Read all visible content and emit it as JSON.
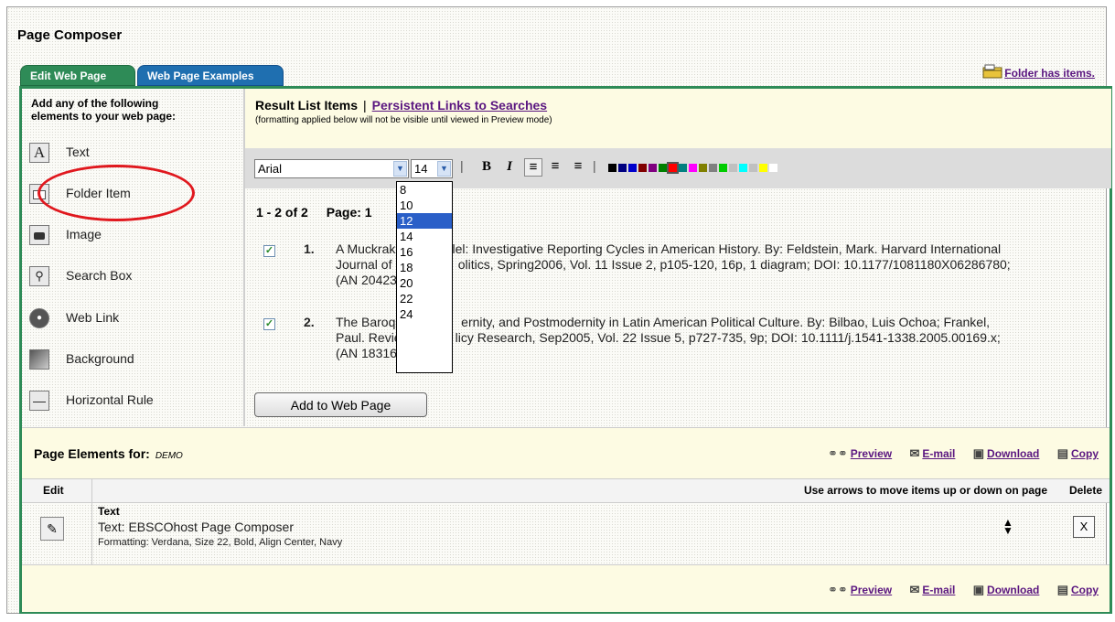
{
  "page_title": "Page Composer",
  "tabs": [
    {
      "label": "Edit Web Page"
    },
    {
      "label": "Web Page Examples"
    }
  ],
  "folder_link": "Folder has items.",
  "left_panel": {
    "title_line1": "Add any of the following",
    "title_line2": "elements to your web page:",
    "elements": [
      {
        "label": "Text",
        "icon": "text-A-icon"
      },
      {
        "label": "Folder Item",
        "icon": "folder-item-icon"
      },
      {
        "label": "Image",
        "icon": "camera-icon"
      },
      {
        "label": "Search Box",
        "icon": "magnifier-icon"
      },
      {
        "label": "Web Link",
        "icon": "globe-link-icon"
      },
      {
        "label": "Background",
        "icon": "background-icon"
      },
      {
        "label": "Horizontal Rule",
        "icon": "horizontal-rule-icon"
      }
    ]
  },
  "result_list": {
    "title": "Result List Items",
    "separator": "|",
    "persistent_link": "Persistent Links to Searches",
    "note": "(formatting applied below will not be visible until viewed in Preview mode)"
  },
  "toolbar": {
    "font": "Arial",
    "size": "14",
    "bold": "B",
    "italic": "I",
    "size_options": [
      "8",
      "10",
      "12",
      "14",
      "16",
      "18",
      "20",
      "22",
      "24"
    ],
    "selected_size_option": "12",
    "swatches": [
      "#000000",
      "#000080",
      "#0000cc",
      "#800000",
      "#800080",
      "#008000",
      "#ff0000",
      "#008080",
      "#ff00ff",
      "#808000",
      "#808080",
      "#00cc00",
      "#c0c0c0",
      "#00ffff",
      "#c0c0c0",
      "#ffff00",
      "#ffffff"
    ]
  },
  "pager": {
    "range": "1 - 2 of 2",
    "page": "Page: 1"
  },
  "items": [
    {
      "num": "1.",
      "line1": "A Muckraki",
      "line1b": "lel: Investigative Reporting Cycles in American History. By: Feldstein, Mark. Harvard International",
      "line2": "Journal of P",
      "line2b": "olitics, Spring2006, Vol. 11 Issue 2, p105-120, 16p, 1 diagram; DOI: 10.1177/1081180X06286780;",
      "line3": "(AN 204237"
    },
    {
      "num": "2.",
      "line1": "The Baroqu",
      "line1b": "ernity, and Postmodernity in Latin American Political Culture. By: Bilbao, Luis Ochoa; Frankel,",
      "line2": "Paul. Revie",
      "line2b": "licy Research, Sep2005, Vol. 22 Issue 5, p727-735, 9p; DOI: 10.1111/j.1541-1338.2005.00169.x;",
      "line3": "(AN 18316316)"
    }
  ],
  "add_button": "Add to Web Page",
  "page_elements": {
    "title": "Page Elements for:",
    "user": "DEMO",
    "actions": [
      "Preview",
      "E-mail",
      "Download",
      "Copy"
    ],
    "col_edit": "Edit",
    "col_hint": "Use arrows to move items up or down on page",
    "col_delete": "Delete",
    "row": {
      "type": "Text",
      "text": "Text: EBSCOhost Page Composer",
      "formatting": "Formatting: Verdana, Size 22, Bold, Align Center, Navy",
      "delete_label": "X"
    }
  }
}
